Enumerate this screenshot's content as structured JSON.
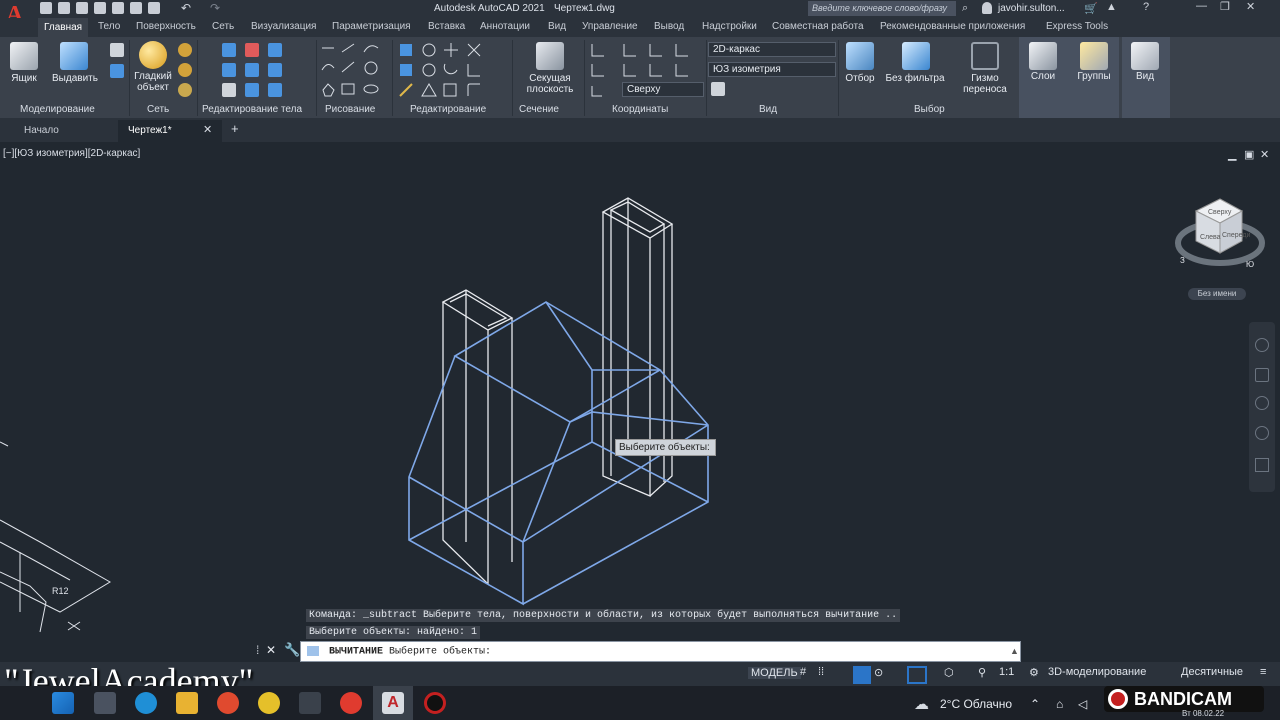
{
  "app": {
    "title": "Autodesk AutoCAD 2021",
    "document": "Чертеж1.dwg",
    "search_placeholder": "Введите ключевое слово/фразу",
    "user": "javohir.sulton..."
  },
  "menu_tabs": [
    "Главная",
    "Тело",
    "Поверхность",
    "Сеть",
    "Визуализация",
    "Параметризация",
    "Вставка",
    "Аннотации",
    "Вид",
    "Управление",
    "Вывод",
    "Надстройки",
    "Совместная работа",
    "Рекомендованные приложения",
    "Express Tools"
  ],
  "ribbon": {
    "box_label": "Ящик",
    "extrude_label": "Выдавить",
    "smooth_label": "Гладкий объект",
    "section_plane_label": "Секущая плоскость",
    "visual_style": "2D-каркас",
    "view_preset": "ЮЗ изометрия",
    "ucs_top": "Сверху",
    "culling_label": "Отбор",
    "no_filter_label": "Без фильтра",
    "gizmo_label": "Гизмо переноса",
    "layers_label": "Слои",
    "groups_label": "Группы",
    "view_label": "Вид",
    "groups": {
      "modeling": "Моделирование",
      "mesh": "Сеть",
      "solid_edit": "Редактирование тела",
      "draw": "Рисование",
      "modify": "Редактирование",
      "section": "Сечение",
      "coords": "Координаты",
      "view": "Вид",
      "selection": "Выбор"
    }
  },
  "file_tabs": {
    "start": "Начало",
    "current": "Чертеж1*"
  },
  "viewport": {
    "label": "[−][ЮЗ изометрия][2D-каркас]",
    "tooltip": "Выберите объекты:",
    "viewcube_top": "Сверху",
    "viewcube_front": "Слева",
    "viewcube_right": "Спереди",
    "compass_w": "З",
    "compass_s": "Ю",
    "wcs_label": "Без имени",
    "dim_label": "R12"
  },
  "command": {
    "history_1": "Команда: _subtract Выберите тела, поверхности и области, из которых будет выполняться вычитание ..",
    "history_2": "Выберите объекты: найдено: 1",
    "name": "ВЫЧИТАНИЕ",
    "prompt": "Выберите объекты:"
  },
  "status": {
    "model": "МОДЕЛЬ",
    "scale": "1:1",
    "workspace": "3D-моделирование",
    "units": "Десятичные"
  },
  "watermark": "\"JewelAcademy\"",
  "taskbar": {
    "weather": "2°C  Облачно",
    "date": "Вт 08.02.22",
    "recorder": "BANDICAM"
  },
  "colors": {
    "accent": "#2b75c8",
    "selection_lines": "#7fa8e8",
    "wire_lines": "#e8eaee"
  }
}
